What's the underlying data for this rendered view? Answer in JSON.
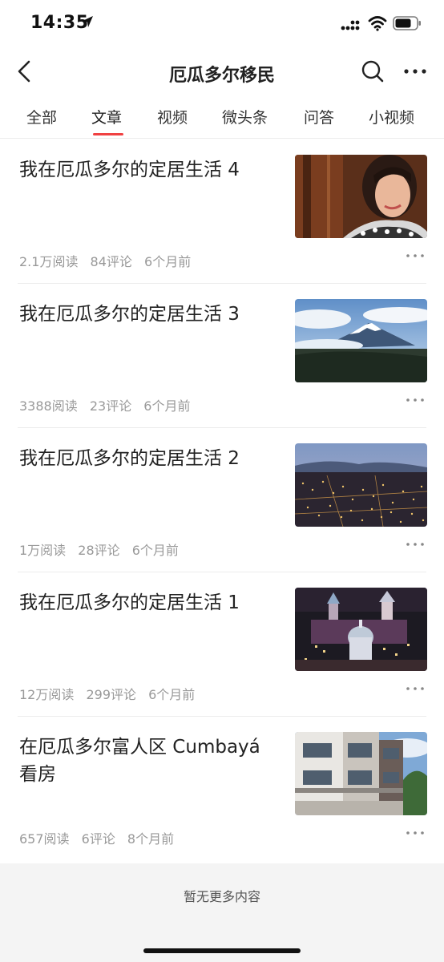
{
  "status_bar": {
    "time": "14:35",
    "icons": [
      "location-arrow-icon",
      "signal-icon",
      "wifi-icon",
      "battery-icon"
    ]
  },
  "nav": {
    "back_icon": "chevron-left-icon",
    "title": "厄瓜多尔移民",
    "search_icon": "search-icon",
    "more_icon": "more-horizontal-icon"
  },
  "tabs": [
    {
      "label": "全部",
      "active": false
    },
    {
      "label": "文章",
      "active": true
    },
    {
      "label": "视频",
      "active": false
    },
    {
      "label": "微头条",
      "active": false
    },
    {
      "label": "问答",
      "active": false
    },
    {
      "label": "小视频",
      "active": false
    }
  ],
  "accent_color": "#f04142",
  "articles": [
    {
      "title": "我在厄瓜多尔的定居生活 4",
      "reads": "2.1万阅读",
      "comments": "84评论",
      "time": "6个月前",
      "thumbnail": "woman-selfie"
    },
    {
      "title": "我在厄瓜多尔的定居生活 3",
      "reads": "3388阅读",
      "comments": "23评论",
      "time": "6个月前",
      "thumbnail": "snowy-volcano"
    },
    {
      "title": "我在厄瓜多尔的定居生活 2",
      "reads": "1万阅读",
      "comments": "28评论",
      "time": "6个月前",
      "thumbnail": "city-lights-valley"
    },
    {
      "title": "我在厄瓜多尔的定居生活 1",
      "reads": "12万阅读",
      "comments": "299评论",
      "time": "6个月前",
      "thumbnail": "night-church-domes"
    },
    {
      "title": "在厄瓜多尔富人区 Cumbayá 看房",
      "reads": "657阅读",
      "comments": "6评论",
      "time": "8个月前",
      "thumbnail": "modern-building"
    }
  ],
  "footer": {
    "text": "暂无更多内容"
  }
}
